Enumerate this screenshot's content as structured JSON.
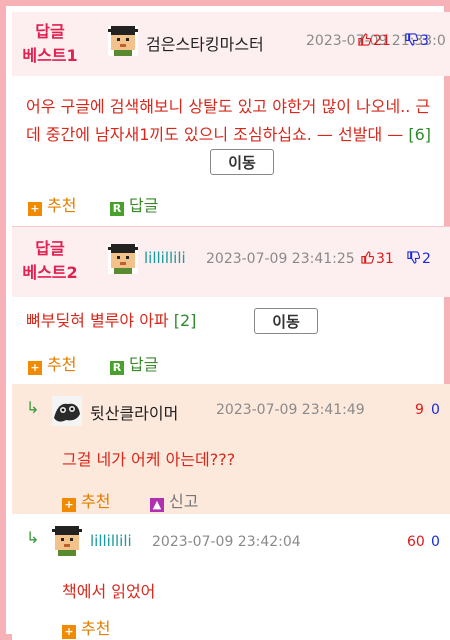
{
  "comments": [
    {
      "badge_line1": "답글",
      "badge_line2": "베스트1",
      "nickname": "검은스타킹마스터",
      "date": "2023-07-09 21:33:0",
      "up": "21",
      "down": "3",
      "content": "어우 구글에 검색해보니 상탈도 있고 야한거 많이 나오네.. 근데 중간에 남자새1끼도 있으니 조심하십쇼. — 선발대 —",
      "count": "[6]",
      "move": "이동",
      "recommend": "추천",
      "reply": "답글"
    },
    {
      "badge_line1": "답글",
      "badge_line2": "베스트2",
      "nickname": "lillillili",
      "date": "2023-07-09 23:41:25",
      "up": "31",
      "down": "2",
      "content": "뼈부딪혀 별루야 아파",
      "count": "[2]",
      "move": "이동",
      "recommend": "추천",
      "reply": "답글"
    }
  ],
  "replies": [
    {
      "arrow": "↳",
      "nickname": "뒷산클라이머",
      "date": "2023-07-09 23:41:49",
      "up": "9",
      "down": "0",
      "content": "그걸 네가 어케 아는데???",
      "recommend": "추천",
      "report": "신고"
    },
    {
      "arrow": "↳",
      "nickname": "lillillili",
      "date": "2023-07-09 23:42:04",
      "up": "60",
      "down": "0",
      "content": "책에서 읽었어",
      "recommend": "추천"
    }
  ],
  "colors": {
    "frame": "#f6b2b6",
    "best_bg": "#fdeff0",
    "reply_bg": "#fde8dc",
    "badge": "#e02050",
    "content": "#d8281c",
    "recommend": "#e27e00",
    "reply": "#3a8a2a",
    "up": "#dd1a1a",
    "down": "#1a2bd6"
  },
  "icons": [
    "thumbs-up-icon",
    "thumbs-down-icon",
    "plus-icon",
    "reply-r-icon",
    "report-icon",
    "reply-arrow-icon",
    "avatar-pixel-face",
    "avatar-dark-creature"
  ]
}
